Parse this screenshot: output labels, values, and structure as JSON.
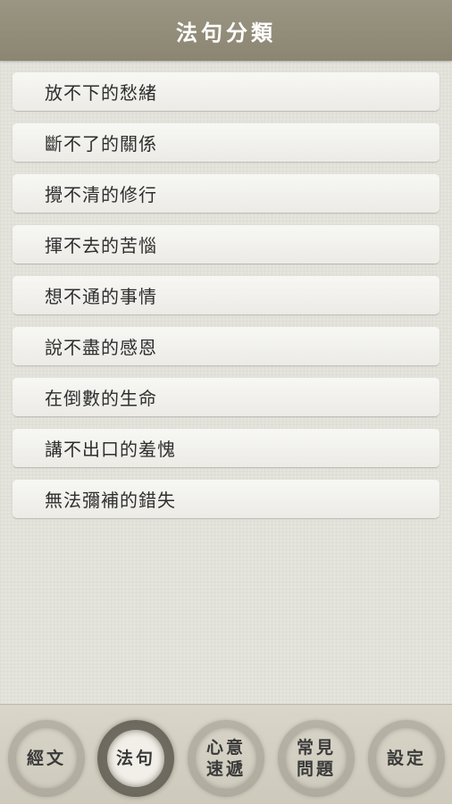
{
  "header": {
    "title": "法句分類"
  },
  "list": {
    "items": [
      {
        "label": "放不下的愁緒"
      },
      {
        "label": "斷不了的關係"
      },
      {
        "label": "攪不清的修行"
      },
      {
        "label": "揮不去的苦惱"
      },
      {
        "label": "想不通的事情"
      },
      {
        "label": "說不盡的感恩"
      },
      {
        "label": "在倒數的生命"
      },
      {
        "label": "講不出口的羞愧"
      },
      {
        "label": "無法彌補的錯失"
      }
    ]
  },
  "tabbar": {
    "active_tab": "法句",
    "tabs": [
      {
        "line1": "經文",
        "line2": ""
      },
      {
        "line1": "法句",
        "line2": ""
      },
      {
        "line1": "心意",
        "line2": "速遞"
      },
      {
        "line1": "常見",
        "line2": "問題"
      },
      {
        "line1": "設定",
        "line2": ""
      }
    ]
  }
}
